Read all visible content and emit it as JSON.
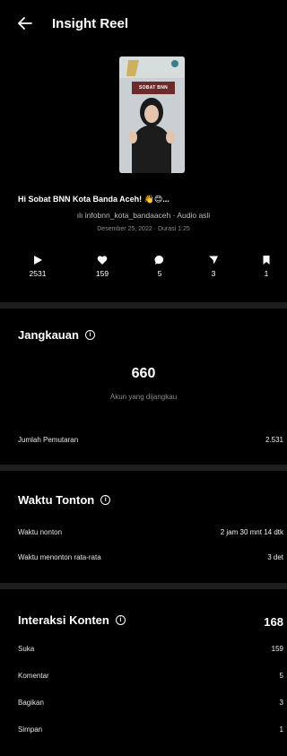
{
  "header": {
    "title": "Insight Reel"
  },
  "reel": {
    "thumbnail_text": "SOBAT BNN",
    "caption": "Hi Sobat BNN Kota Banda Aceh! 👋😊...",
    "audio": "infobnn_kota_bandaaceh · Audio asli",
    "meta": "Desember 25, 2022 · Durasi 1:25"
  },
  "stats": [
    {
      "icon": "play-icon",
      "value": "2531"
    },
    {
      "icon": "heart-icon",
      "value": "159"
    },
    {
      "icon": "comment-icon",
      "value": "5"
    },
    {
      "icon": "share-icon",
      "value": "3"
    },
    {
      "icon": "bookmark-icon",
      "value": "1"
    }
  ],
  "reach": {
    "title": "Jangkauan",
    "value": "660",
    "label": "Akun yang dijangkau",
    "plays_label": "Jumlah Pemutaran",
    "plays_value": "2.531"
  },
  "watch": {
    "title": "Waktu Tonton",
    "time_label": "Waktu nonton",
    "time_value": "2 jam 30 mnt 14 dtk",
    "avg_label": "Waktu menonton rata-rata",
    "avg_value": "3 det"
  },
  "interactions": {
    "title": "Interaksi Konten",
    "total": "168",
    "rows": [
      {
        "label": "Suka",
        "value": "159"
      },
      {
        "label": "Komentar",
        "value": "5"
      },
      {
        "label": "Bagikan",
        "value": "3"
      },
      {
        "label": "Simpan",
        "value": "1"
      }
    ]
  },
  "colors": {
    "background": "#000000",
    "divider": "#1e1e1e",
    "muted": "#8a8a8a"
  }
}
